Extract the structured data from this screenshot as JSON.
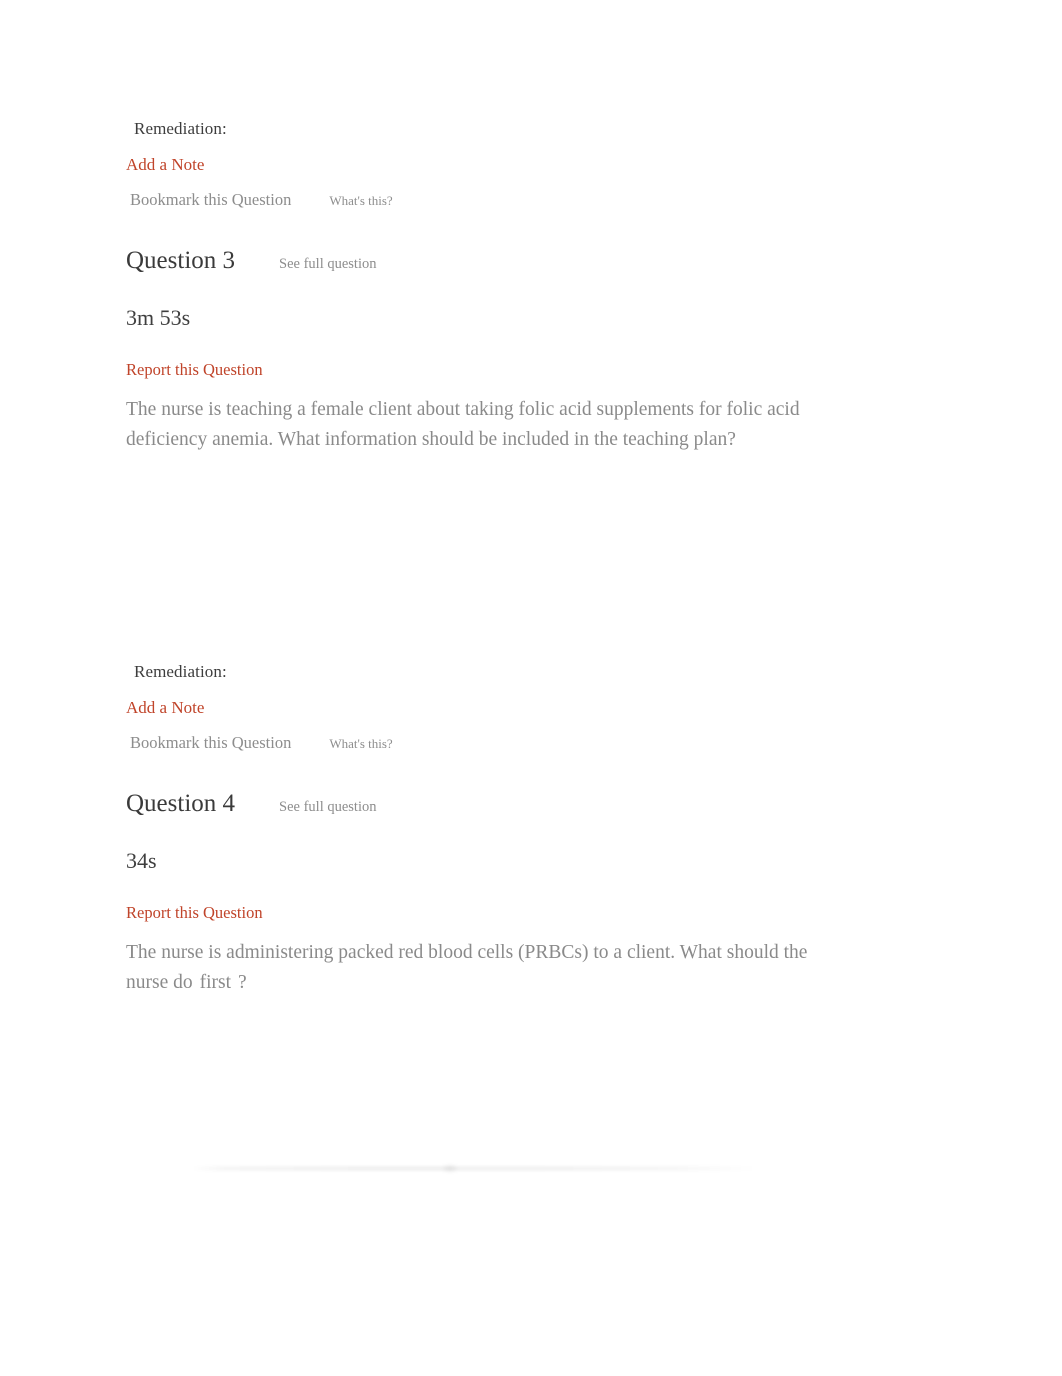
{
  "document": {
    "type": "quiz-review-page",
    "accent_link_color": "#c0442a",
    "body_text_color": "#8a8a8a",
    "muted_text_color": "#8d8d8d"
  },
  "question_blocks": [
    {
      "remediation_label": "Remediation:",
      "add_note_label": "Add a Note",
      "bookmark_label": "Bookmark this Question",
      "whats_this_label": "What's this?",
      "title": "Question 3",
      "see_full_label": "See full question",
      "elapsed_time": "3m 53s",
      "report_label": "Report this Question",
      "text_before": "The nurse is teaching a female client about taking folic acid supplements for folic acid deficiency anemia. What information should be included in the teaching plan?",
      "emphasis": "",
      "text_after": ""
    },
    {
      "remediation_label": "Remediation:",
      "add_note_label": "Add a Note",
      "bookmark_label": "Bookmark this Question",
      "whats_this_label": "What's this?",
      "title": "Question 4",
      "see_full_label": "See full question",
      "elapsed_time": "34s",
      "report_label": "Report this Question",
      "text_before": "The nurse is administering packed red blood cells (PRBCs) to a client. What should the nurse do",
      "emphasis": "first",
      "text_after": "?"
    }
  ]
}
